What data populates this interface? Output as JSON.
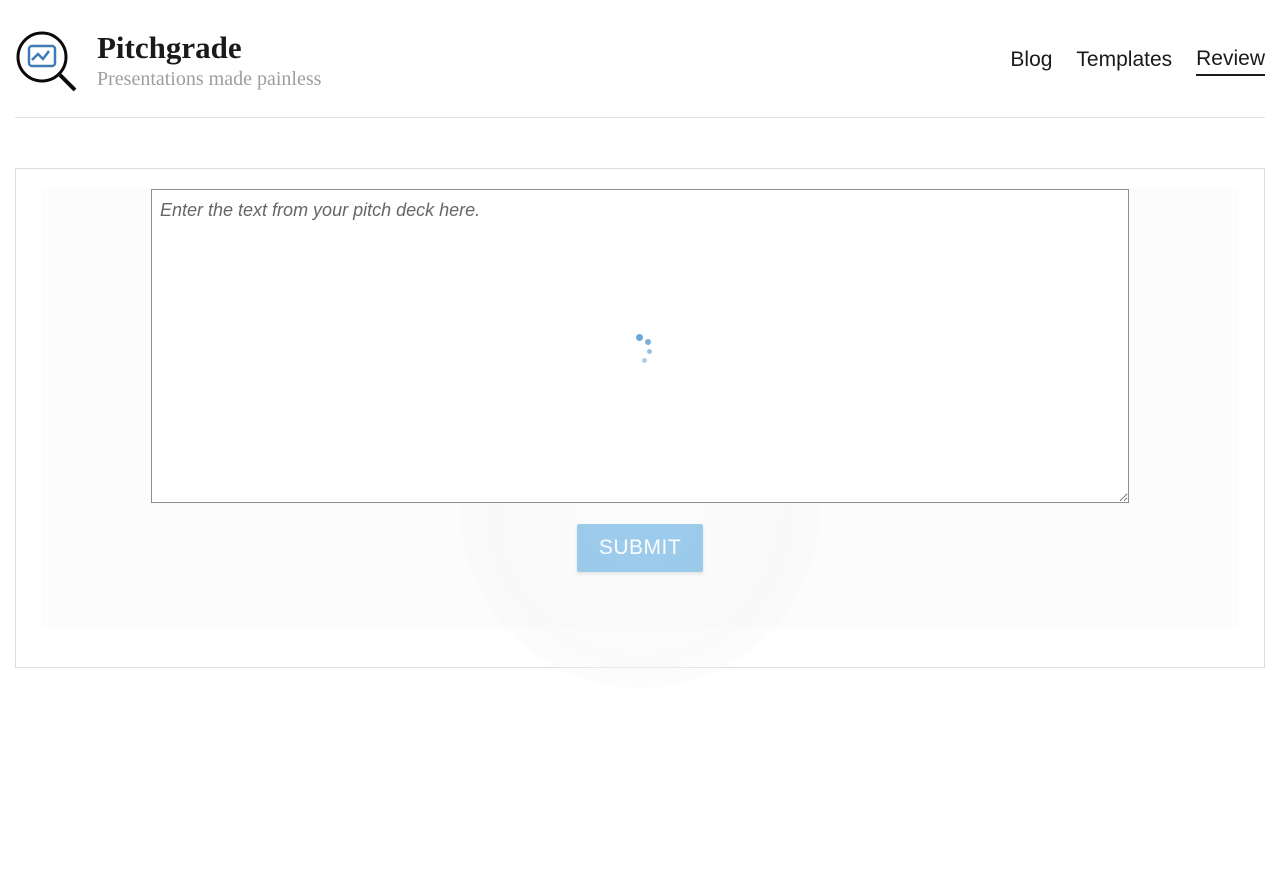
{
  "brand": {
    "title": "Pitchgrade",
    "tagline": "Presentations made painless"
  },
  "nav": {
    "blog": "Blog",
    "templates": "Templates",
    "review": "Review"
  },
  "form": {
    "textarea_placeholder": "Enter the text from your pitch deck here.",
    "textarea_value": "",
    "submit_label": "SUBMIT"
  }
}
